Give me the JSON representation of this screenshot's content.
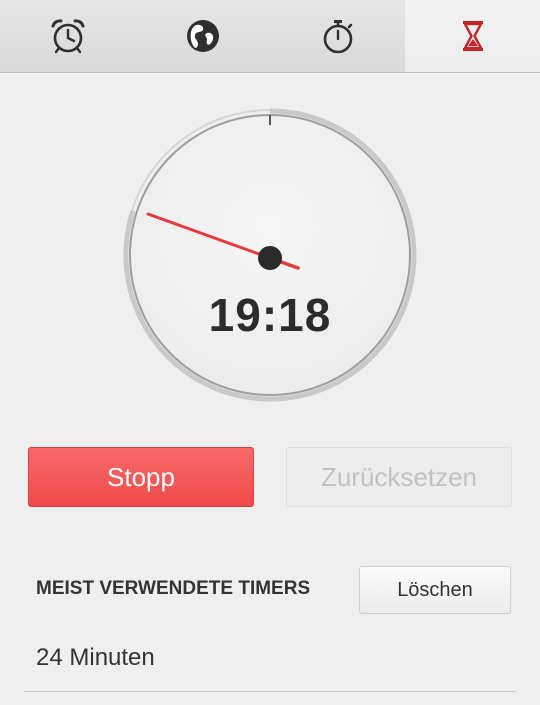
{
  "tabs": [
    {
      "name": "alarm-clock-icon",
      "active": false
    },
    {
      "name": "globe-icon",
      "active": false
    },
    {
      "name": "stopwatch-icon",
      "active": false
    },
    {
      "name": "hourglass-icon",
      "active": true
    }
  ],
  "colors": {
    "accent": "#e8383d",
    "text": "#2b2b2b",
    "tab_icon": "#2f2f2f"
  },
  "timer": {
    "time": "19:18",
    "remaining_fraction": 0.8
  },
  "buttons": {
    "stop": "Stopp",
    "reset": "Zurücksetzen"
  },
  "recent": {
    "title": "MEIST VERWENDETE TIMERS",
    "clear": "Löschen",
    "items": [
      "24 Minuten"
    ]
  }
}
